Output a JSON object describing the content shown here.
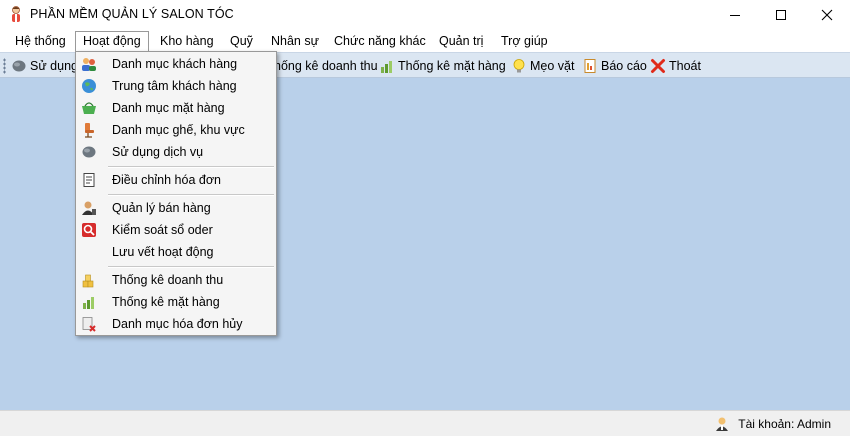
{
  "window": {
    "title": "PHẦN MỀM QUẢN LÝ SALON TÓC"
  },
  "menu": [
    {
      "label": "Hệ thống",
      "active": false
    },
    {
      "label": "Hoạt động",
      "active": true
    },
    {
      "label": "Kho hàng",
      "active": false
    },
    {
      "label": "Quỹ",
      "active": false
    },
    {
      "label": "Nhân sự",
      "active": false
    },
    {
      "label": "Chức năng khác",
      "active": false
    },
    {
      "label": "Quản trị",
      "active": false
    },
    {
      "label": "Trợ giúp",
      "active": false
    }
  ],
  "toolbar": [
    {
      "label": "Sử dụng",
      "icon": "service-icon"
    },
    {
      "label": "hống kê doanh thu",
      "icon": ""
    },
    {
      "label": "Thống kê mặt hàng",
      "icon": "product-stats-icon"
    },
    {
      "label": "Mẹo vặt",
      "icon": "lightbulb-icon"
    },
    {
      "label": "Báo cáo",
      "icon": "report-icon"
    },
    {
      "label": "Thoát",
      "icon": "exit-icon"
    }
  ],
  "dropdown": {
    "groups": [
      [
        {
          "label": "Danh mục khách hàng",
          "icon": "customers-icon"
        },
        {
          "label": "Trung tâm khách hàng",
          "icon": "globe-icon"
        },
        {
          "label": "Danh mục mặt hàng",
          "icon": "basket-icon"
        },
        {
          "label": "Danh mục ghế, khu vực",
          "icon": "chair-icon"
        },
        {
          "label": "Sử dụng dịch vụ",
          "icon": "service-icon"
        }
      ],
      [
        {
          "label": "Điều chỉnh hóa đơn",
          "icon": "invoice-edit-icon"
        }
      ],
      [
        {
          "label": "Quản lý bán hàng",
          "icon": "sales-manager-icon"
        },
        {
          "label": "Kiểm soát sổ oder",
          "icon": "order-book-icon"
        },
        {
          "label": "Lưu vết hoạt động",
          "icon": ""
        }
      ],
      [
        {
          "label": "Thống kê doanh thu",
          "icon": "revenue-stats-icon"
        },
        {
          "label": "Thống kê mặt hàng",
          "icon": "product-stats-icon"
        },
        {
          "label": "Danh mục hóa đơn hủy",
          "icon": "cancelled-invoice-icon"
        }
      ]
    ]
  },
  "status": {
    "account": "Tài khoản: Admin"
  }
}
